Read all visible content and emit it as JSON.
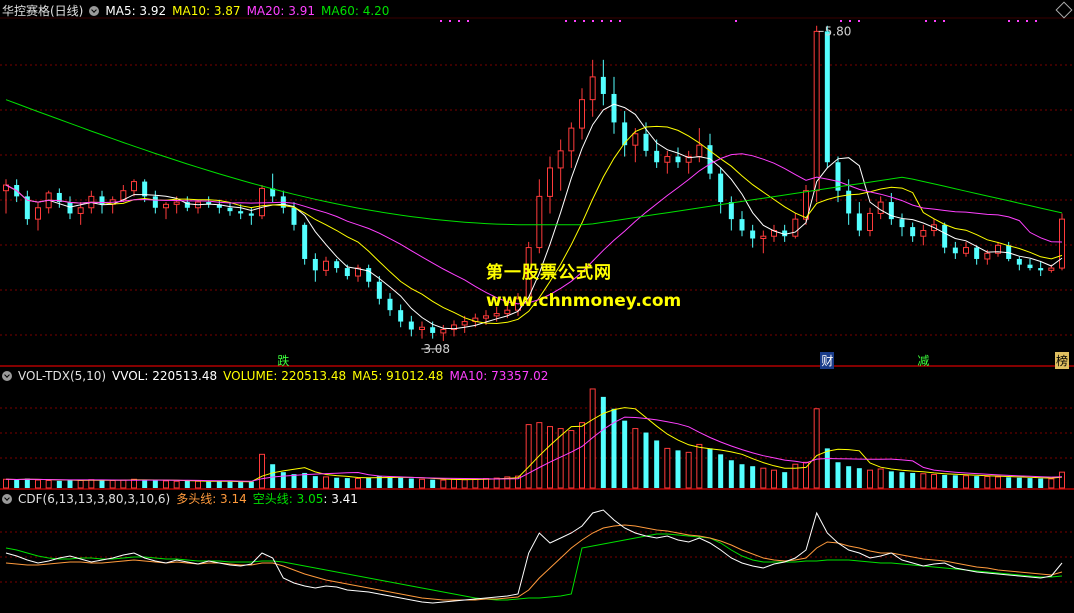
{
  "panel1": {
    "title": "华控赛格(日线)",
    "ma5": "MA5: 3.92",
    "ma10": "MA10: 3.87",
    "ma20": "MA20: 3.91",
    "ma60": "MA60: 4.20",
    "high_label": "5.80",
    "low_label": "3.08",
    "events": [
      "跌",
      "财",
      "减",
      "榜"
    ]
  },
  "panel2": {
    "title": "VOL-TDX(5,10)",
    "vvol": "VVOL: 220513.48",
    "volume": "VOLUME: 220513.48",
    "ma5": "MA5: 91012.48",
    "ma10": "MA10: 73357.02"
  },
  "panel3": {
    "title": "CDF(6,13,13,3,80,3,10,6)",
    "long": "多头线: 3.14",
    "short": "空头线: 3.05",
    "val": ": 3.41"
  },
  "watermark": {
    "line1": "第一股票公式网",
    "line2": "www.chnmoney.com"
  },
  "colors": {
    "up": "#ff3b3b",
    "down": "#54ffff",
    "ma5": "#ffffff",
    "ma10": "#ffff00",
    "ma20": "#ff40ff",
    "ma60": "#00e000",
    "long": "#ff9a3c",
    "short": "#00e000",
    "grid": "#7a0000"
  },
  "chart_data": {
    "type": "candlestick",
    "price_range": [
      3.0,
      5.9
    ],
    "events": [
      {
        "label": "跌",
        "index": 26
      },
      {
        "label": "财",
        "index": 77
      },
      {
        "label": "减",
        "index": 86
      },
      {
        "label": "榜",
        "index": 99
      }
    ],
    "candles": [
      [
        4.4,
        4.5,
        4.2,
        4.45
      ],
      [
        4.45,
        4.5,
        4.3,
        4.35
      ],
      [
        4.35,
        4.4,
        4.1,
        4.15
      ],
      [
        4.15,
        4.3,
        4.05,
        4.25
      ],
      [
        4.25,
        4.4,
        4.2,
        4.38
      ],
      [
        4.38,
        4.42,
        4.25,
        4.3
      ],
      [
        4.3,
        4.35,
        4.15,
        4.2
      ],
      [
        4.2,
        4.3,
        4.1,
        4.25
      ],
      [
        4.25,
        4.4,
        4.2,
        4.35
      ],
      [
        4.35,
        4.4,
        4.2,
        4.28
      ],
      [
        4.28,
        4.35,
        4.2,
        4.32
      ],
      [
        4.32,
        4.45,
        4.3,
        4.4
      ],
      [
        4.4,
        4.5,
        4.35,
        4.48
      ],
      [
        4.48,
        4.5,
        4.3,
        4.35
      ],
      [
        4.35,
        4.4,
        4.2,
        4.25
      ],
      [
        4.25,
        4.3,
        4.15,
        4.28
      ],
      [
        4.28,
        4.35,
        4.2,
        4.3
      ],
      [
        4.3,
        4.35,
        4.22,
        4.25
      ],
      [
        4.25,
        4.32,
        4.2,
        4.3
      ],
      [
        4.3,
        4.35,
        4.25,
        4.28
      ],
      [
        4.28,
        4.32,
        4.2,
        4.25
      ],
      [
        4.25,
        4.3,
        4.18,
        4.22
      ],
      [
        4.22,
        4.28,
        4.15,
        4.2
      ],
      [
        4.2,
        4.25,
        4.1,
        4.18
      ],
      [
        4.18,
        4.45,
        4.15,
        4.42
      ],
      [
        4.42,
        4.55,
        4.3,
        4.35
      ],
      [
        4.35,
        4.4,
        4.2,
        4.25
      ],
      [
        4.25,
        4.3,
        4.05,
        4.1
      ],
      [
        4.1,
        4.12,
        3.75,
        3.8
      ],
      [
        3.8,
        3.85,
        3.6,
        3.7
      ],
      [
        3.7,
        3.82,
        3.65,
        3.78
      ],
      [
        3.78,
        3.8,
        3.68,
        3.72
      ],
      [
        3.72,
        3.75,
        3.62,
        3.65
      ],
      [
        3.65,
        3.75,
        3.6,
        3.72
      ],
      [
        3.72,
        3.75,
        3.55,
        3.6
      ],
      [
        3.6,
        3.65,
        3.4,
        3.45
      ],
      [
        3.45,
        3.5,
        3.3,
        3.35
      ],
      [
        3.35,
        3.4,
        3.2,
        3.25
      ],
      [
        3.25,
        3.3,
        3.12,
        3.18
      ],
      [
        3.18,
        3.25,
        3.1,
        3.2
      ],
      [
        3.2,
        3.25,
        3.1,
        3.15
      ],
      [
        3.15,
        3.22,
        3.08,
        3.18
      ],
      [
        3.18,
        3.26,
        3.12,
        3.22
      ],
      [
        3.22,
        3.3,
        3.15,
        3.25
      ],
      [
        3.25,
        3.32,
        3.2,
        3.28
      ],
      [
        3.28,
        3.35,
        3.22,
        3.3
      ],
      [
        3.3,
        3.38,
        3.25,
        3.32
      ],
      [
        3.32,
        3.4,
        3.28,
        3.35
      ],
      [
        3.35,
        3.5,
        3.3,
        3.45
      ],
      [
        3.45,
        3.95,
        3.42,
        3.9
      ],
      [
        3.9,
        4.5,
        3.85,
        4.35
      ],
      [
        4.35,
        4.7,
        4.2,
        4.6
      ],
      [
        4.6,
        4.85,
        4.4,
        4.75
      ],
      [
        4.75,
        5.0,
        4.6,
        4.95
      ],
      [
        4.95,
        5.3,
        4.85,
        5.2
      ],
      [
        5.2,
        5.55,
        5.05,
        5.4
      ],
      [
        5.4,
        5.55,
        5.15,
        5.25
      ],
      [
        5.25,
        5.4,
        4.9,
        5.0
      ],
      [
        5.0,
        5.1,
        4.7,
        4.8
      ],
      [
        4.8,
        4.95,
        4.65,
        4.9
      ],
      [
        4.9,
        5.0,
        4.7,
        4.75
      ],
      [
        4.75,
        4.85,
        4.6,
        4.65
      ],
      [
        4.65,
        4.75,
        4.55,
        4.7
      ],
      [
        4.7,
        4.78,
        4.6,
        4.65
      ],
      [
        4.65,
        4.75,
        4.55,
        4.7
      ],
      [
        4.7,
        4.95,
        4.65,
        4.8
      ],
      [
        4.8,
        4.9,
        4.5,
        4.55
      ],
      [
        4.55,
        4.6,
        4.2,
        4.3
      ],
      [
        4.3,
        4.35,
        4.05,
        4.15
      ],
      [
        4.15,
        4.22,
        4.0,
        4.05
      ],
      [
        4.05,
        4.1,
        3.9,
        3.98
      ],
      [
        3.98,
        4.05,
        3.85,
        4.0
      ],
      [
        4.0,
        4.1,
        3.95,
        4.05
      ],
      [
        4.05,
        4.1,
        3.95,
        4.0
      ],
      [
        4.0,
        4.2,
        3.98,
        4.15
      ],
      [
        4.15,
        4.45,
        4.1,
        4.4
      ],
      [
        4.4,
        5.85,
        4.3,
        5.8
      ],
      [
        5.8,
        5.85,
        4.6,
        4.65
      ],
      [
        4.65,
        4.7,
        4.3,
        4.4
      ],
      [
        4.4,
        4.5,
        4.1,
        4.2
      ],
      [
        4.2,
        4.3,
        4.0,
        4.05
      ],
      [
        4.05,
        4.25,
        4.0,
        4.2
      ],
      [
        4.2,
        4.35,
        4.15,
        4.3
      ],
      [
        4.3,
        4.38,
        4.1,
        4.15
      ],
      [
        4.15,
        4.2,
        4.0,
        4.08
      ],
      [
        4.08,
        4.12,
        3.95,
        4.0
      ],
      [
        4.0,
        4.1,
        3.92,
        4.05
      ],
      [
        4.05,
        4.15,
        4.0,
        4.1
      ],
      [
        4.1,
        4.12,
        3.85,
        3.9
      ],
      [
        3.9,
        3.95,
        3.8,
        3.85
      ],
      [
        3.85,
        3.95,
        3.82,
        3.9
      ],
      [
        3.9,
        3.92,
        3.75,
        3.8
      ],
      [
        3.8,
        3.88,
        3.75,
        3.85
      ],
      [
        3.85,
        3.95,
        3.82,
        3.92
      ],
      [
        3.92,
        3.95,
        3.78,
        3.8
      ],
      [
        3.8,
        3.82,
        3.7,
        3.75
      ],
      [
        3.75,
        3.8,
        3.7,
        3.72
      ],
      [
        3.72,
        3.78,
        3.65,
        3.7
      ],
      [
        3.7,
        3.75,
        3.68,
        3.72
      ],
      [
        3.72,
        4.2,
        3.7,
        4.15
      ]
    ],
    "volume_range": [
      0,
      260000
    ],
    "volume": [
      22000,
      21000,
      24000,
      20000,
      19000,
      18000,
      20000,
      19000,
      21000,
      20000,
      19000,
      20000,
      22000,
      21000,
      19000,
      18000,
      17000,
      18000,
      17000,
      16000,
      17000,
      16000,
      15000,
      16000,
      85000,
      60000,
      40000,
      35000,
      38000,
      30000,
      28000,
      26000,
      25000,
      24000,
      26000,
      30000,
      28000,
      26000,
      24000,
      22000,
      21000,
      20000,
      22000,
      21000,
      23000,
      24000,
      25000,
      28000,
      30000,
      160000,
      165000,
      155000,
      150000,
      145000,
      165000,
      250000,
      230000,
      200000,
      170000,
      150000,
      140000,
      120000,
      100000,
      95000,
      90000,
      110000,
      100000,
      85000,
      70000,
      60000,
      55000,
      50000,
      45000,
      40000,
      60000,
      65000,
      200000,
      100000,
      65000,
      55000,
      50000,
      45000,
      48000,
      42000,
      40000,
      38000,
      36000,
      34000,
      33000,
      32000,
      31000,
      30000,
      29000,
      28000,
      27000,
      26000,
      25000,
      24000,
      23000,
      40000
    ],
    "cdf_range": [
      0,
      100
    ],
    "cdf_white": [
      55,
      52,
      48,
      45,
      47,
      50,
      52,
      49,
      46,
      48,
      50,
      53,
      55,
      50,
      47,
      45,
      48,
      46,
      44,
      47,
      45,
      43,
      42,
      44,
      55,
      50,
      30,
      25,
      22,
      20,
      22,
      21,
      18,
      17,
      16,
      14,
      12,
      10,
      8,
      6,
      5,
      6,
      7,
      8,
      9,
      10,
      11,
      12,
      14,
      55,
      75,
      65,
      70,
      75,
      82,
      95,
      98,
      88,
      80,
      75,
      72,
      70,
      72,
      68,
      66,
      70,
      65,
      58,
      50,
      45,
      42,
      40,
      44,
      46,
      50,
      58,
      95,
      75,
      65,
      58,
      55,
      50,
      52,
      55,
      48,
      45,
      42,
      44,
      45,
      40,
      38,
      36,
      35,
      34,
      33,
      32,
      31,
      30,
      32,
      45
    ],
    "cdf_long": [
      45,
      44,
      43,
      43,
      44,
      45,
      46,
      46,
      45,
      45,
      46,
      47,
      48,
      47,
      46,
      45,
      46,
      45,
      44,
      45,
      45,
      44,
      43,
      43,
      45,
      45,
      42,
      38,
      34,
      31,
      28,
      26,
      24,
      22,
      20,
      18,
      16,
      14,
      12,
      10,
      9,
      8,
      8,
      8,
      8,
      9,
      9,
      10,
      11,
      18,
      30,
      40,
      50,
      60,
      68,
      75,
      80,
      82,
      83,
      82,
      80,
      78,
      77,
      75,
      73,
      72,
      70,
      67,
      63,
      58,
      54,
      50,
      48,
      47,
      48,
      50,
      60,
      66,
      65,
      62,
      60,
      57,
      55,
      55,
      53,
      51,
      49,
      48,
      47,
      45,
      43,
      41,
      40,
      38,
      37,
      36,
      35,
      34,
      33,
      36
    ],
    "cdf_short": [
      60,
      58,
      55,
      52,
      50,
      49,
      49,
      50,
      50,
      49,
      49,
      50,
      51,
      51,
      50,
      49,
      49,
      48,
      47,
      47,
      47,
      46,
      46,
      46,
      47,
      47,
      46,
      44,
      42,
      40,
      38,
      36,
      34,
      32,
      30,
      28,
      26,
      24,
      22,
      20,
      18,
      16,
      14,
      12,
      10,
      9,
      8,
      8,
      9,
      10,
      10,
      11,
      12,
      14,
      60,
      62,
      64,
      66,
      68,
      70,
      72,
      74,
      74,
      73,
      72,
      71,
      70,
      65,
      58,
      52,
      48,
      46,
      46,
      46,
      46,
      47,
      47,
      48,
      48,
      48,
      47,
      46,
      45,
      45,
      44,
      43,
      42,
      41,
      40,
      39,
      38,
      37,
      36,
      35,
      34,
      33,
      32,
      31,
      31,
      32
    ]
  }
}
